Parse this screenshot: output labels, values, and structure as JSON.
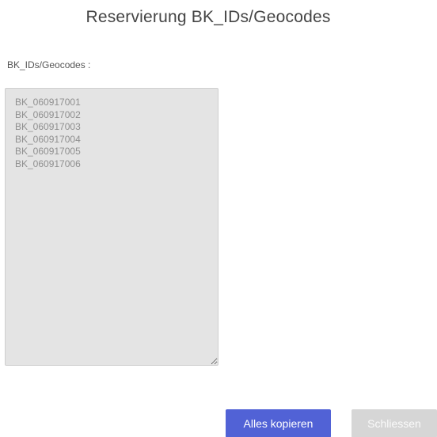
{
  "dialog": {
    "title": "Reservierung BK_IDs/Geocodes",
    "field_label": "BK_IDs/Geocodes :",
    "ids_value": "BK_060917001\nBK_060917002\nBK_060917003\nBK_060917004\nBK_060917005\nBK_060917006",
    "copy_label": "Alles kopieren",
    "close_label": "Schliessen"
  },
  "colors": {
    "primary_button": "#5162d6",
    "disabled_button": "#d6d6d6",
    "textarea_bg": "#e4e4e4"
  }
}
